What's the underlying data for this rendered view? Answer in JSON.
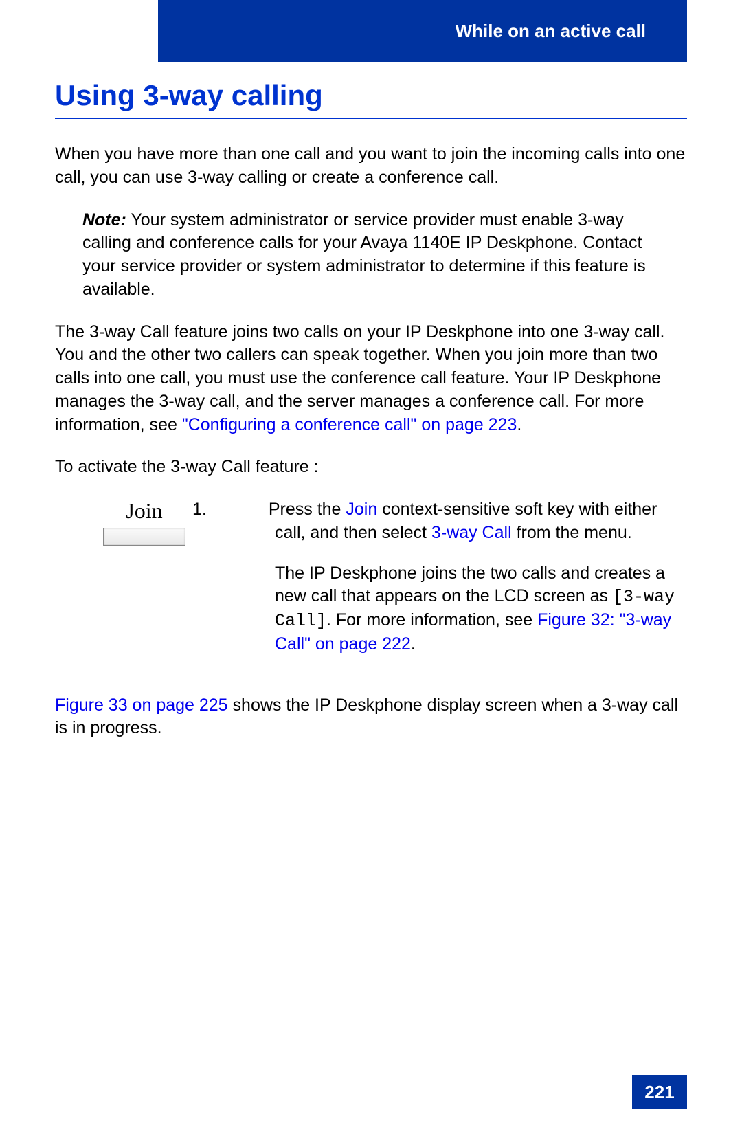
{
  "header": {
    "chapter": "While on an active call"
  },
  "section": {
    "title": "Using 3-way calling"
  },
  "intro": "When you have more than one call and you want to join the incoming calls into one call, you can use 3-way calling or create a conference call.",
  "note": {
    "label": "Note:",
    "text": "  Your system administrator or service provider must enable 3-way calling and conference calls for your Avaya 1140E IP Deskphone. Contact your service provider or system administrator to determine if this feature is available."
  },
  "para2_pre": "The 3-way Call feature joins two calls on your IP Deskphone into one 3-way call. You and the other two callers can speak together. When you join more than two calls into one call, you must use the conference call feature. Your IP Deskphone manages the 3-way call, and the server manages a conference call. For more information, see ",
  "para2_link": "\"Configuring a conference call\" on page 223",
  "para2_post": ".",
  "activate_line": "To activate the 3-way Call feature   :",
  "softkey": {
    "label": "Join"
  },
  "step1": {
    "num": "1.",
    "pre": "Press the ",
    "link1": "Join",
    "mid1": "  context-sensitive soft key with either call, and then select ",
    "link2": "3-way Call",
    "post1": "  from the menu."
  },
  "step1b": {
    "pre": "The IP Deskphone joins the two calls and creates a new call that appears on the LCD screen as ",
    "mono": "[3-way Call]",
    "mid": ". For more information, see ",
    "link": "Figure 32: \"3-way Call\" on page 222",
    "post": "."
  },
  "closing": {
    "link": "Figure 33 on page 225",
    "post": " shows the IP Deskphone display screen when a 3-way call is in progress."
  },
  "page_number": "221"
}
